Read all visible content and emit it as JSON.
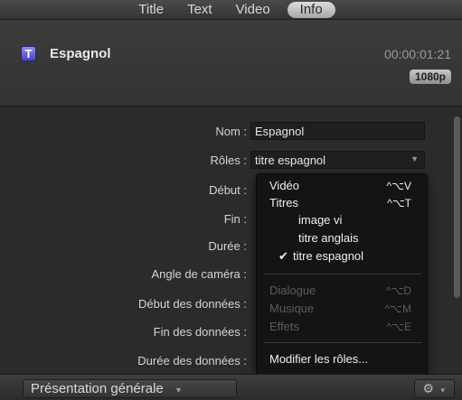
{
  "tabs": [
    "Title",
    "Text",
    "Video",
    "Info"
  ],
  "active_tab": "Info",
  "header": {
    "icon_glyph": "T",
    "clip_name": "Espagnol",
    "timecode": "00:00:01:21",
    "resolution": "1080p"
  },
  "properties": {
    "nom_label": "Nom :",
    "nom_value": "Espagnol",
    "roles_label": "Rôles :",
    "roles_value": "titre espagnol",
    "debut_label": "Début :",
    "fin_label": "Fin :",
    "duree_label": "Durée :",
    "angle_label": "Angle de caméra :",
    "debut_donnees_label": "Début des données :",
    "fin_donnees_label": "Fin des données :",
    "duree_donnees_label": "Durée des données :"
  },
  "roles_menu": {
    "items": [
      {
        "label": "Vidéo",
        "shortcut": "^⌥V",
        "enabled": true
      },
      {
        "label": "Titres",
        "shortcut": "^⌥T",
        "enabled": true
      },
      {
        "label": "image vi",
        "enabled": true
      },
      {
        "label": "titre anglais",
        "enabled": true
      },
      {
        "label": "titre espagnol",
        "enabled": true,
        "checked": true
      },
      {
        "label": "Dialogue",
        "shortcut": "^⌥D",
        "enabled": false
      },
      {
        "label": "Musique",
        "shortcut": "^⌥M",
        "enabled": false
      },
      {
        "label": "Effets",
        "shortcut": "^⌥E",
        "enabled": false
      },
      {
        "label": "Modifier les rôles...",
        "enabled": true
      }
    ],
    "check_glyph": "✔"
  },
  "bottom": {
    "view_label": "Présentation générale",
    "dropdown_arrow": "▼",
    "gear_glyph": "⚙"
  }
}
